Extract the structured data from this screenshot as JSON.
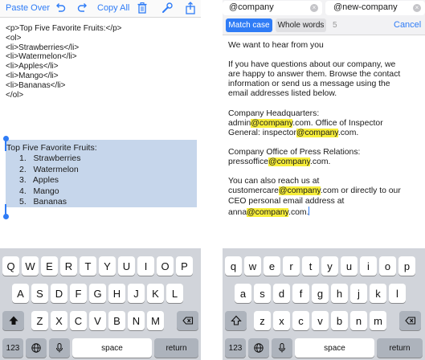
{
  "left": {
    "toolbar": {
      "paste_over": "Paste Over",
      "copy_all": "Copy All"
    },
    "source_lines": [
      "<p>Top Five Favorite Fruits:</p>",
      "<ol>",
      "<li>Strawberries</li>",
      "<li>Watermelon</li>",
      "<li>Apples</li>",
      "<li>Mango</li>",
      "<li>Bananas</li>",
      "</ol>"
    ],
    "rendered": {
      "title": "Top Five Favorite Fruits:",
      "items": [
        "1.   Strawberries",
        "2.   Watermelon",
        "3.   Apples",
        "4.   Mango",
        "5.   Bananas"
      ]
    },
    "keyboard": {
      "row1": [
        "Q",
        "W",
        "E",
        "R",
        "T",
        "Y",
        "U",
        "I",
        "O",
        "P"
      ],
      "row2": [
        "A",
        "S",
        "D",
        "F",
        "G",
        "H",
        "J",
        "K",
        "L"
      ],
      "row3": [
        "Z",
        "X",
        "C",
        "V",
        "B",
        "N",
        "M"
      ],
      "numbers": "123",
      "space": "space",
      "return": "return"
    }
  },
  "right": {
    "find": {
      "search_value": "@company",
      "replace_value": "@new-company",
      "match_case": "Match case",
      "whole_words": "Whole words",
      "count": "5",
      "cancel": "Cancel"
    },
    "document": {
      "line1": "We want to hear from you",
      "p2": [
        "If you have questions about our company, we",
        "are happy to answer them. Browse the contact",
        "information or send us a message using the",
        "email addresses listed below."
      ],
      "hq_label": "Company Headquarters:",
      "hq_a": "admin",
      "hq_b": ".com. Office of Inspector",
      "ig_a": "General: inspector",
      "ig_b": ".com.",
      "pr_label": "Company Office of Press Relations:",
      "pr_a": "pressoffice",
      "pr_b": ".com.",
      "reach": "You can also reach us at",
      "cc_a": "customercare",
      "cc_b": ".com or directly to our",
      "ceo": "CEO personal email address at",
      "anna_a": "anna",
      "anna_b": ".com.",
      "match": "@company"
    },
    "keyboard": {
      "row1": [
        "q",
        "w",
        "e",
        "r",
        "t",
        "y",
        "u",
        "i",
        "o",
        "p"
      ],
      "row2": [
        "a",
        "s",
        "d",
        "f",
        "g",
        "h",
        "j",
        "k",
        "l"
      ],
      "row3": [
        "z",
        "x",
        "c",
        "v",
        "b",
        "n",
        "m"
      ],
      "numbers": "123",
      "space": "space",
      "return": "return"
    }
  },
  "colors": {
    "accent": "#2f7cf6",
    "highlight": "#f7ee3a",
    "selection": "#c6d6eb",
    "keyboard_bg": "#d1d4da"
  }
}
